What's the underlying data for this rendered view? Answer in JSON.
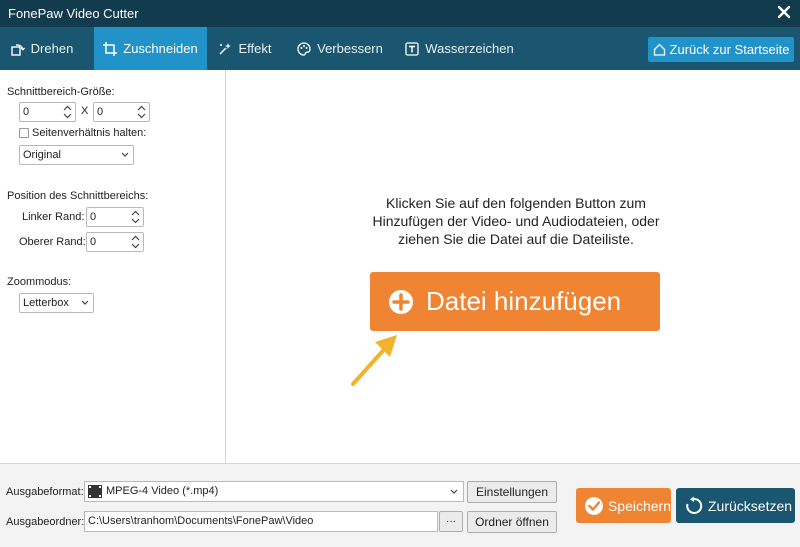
{
  "window": {
    "title": "FonePaw Video Cutter"
  },
  "tabs": [
    {
      "label": "Drehen",
      "icon": "rotate-icon"
    },
    {
      "label": "Zuschneiden",
      "icon": "crop-icon",
      "active": true
    },
    {
      "label": "Effekt",
      "icon": "effect-icon"
    },
    {
      "label": "Verbessern",
      "icon": "palette-icon"
    },
    {
      "label": "Wasserzeichen",
      "icon": "watermark-icon"
    }
  ],
  "home_button": {
    "label": "Zurück zur Startseite",
    "icon": "home-icon"
  },
  "crop": {
    "size_label": "Schnittbereich-Größe:",
    "width": "0",
    "x_label": "X",
    "height": "0",
    "keep_ratio_label": "Seitenverhältnis halten:",
    "keep_ratio_checked": false,
    "ratio_value": "Original"
  },
  "position": {
    "label": "Position des Schnittbereichs:",
    "left_label": "Linker Rand:",
    "left_value": "0",
    "top_label": "Oberer Rand:",
    "top_value": "0"
  },
  "zoom": {
    "label": "Zoommodus:",
    "value": "Letterbox"
  },
  "dropzone": {
    "hint_line1": "Klicken Sie auf den folgenden Button zum",
    "hint_line2": "Hinzufügen der Video- und Audiodateien, oder",
    "hint_line3": "ziehen Sie die Datei auf die Dateiliste.",
    "add_label": "Datei hinzufügen"
  },
  "output": {
    "format_label": "Ausgabeformat:",
    "format_value": "MPEG-4 Video (*.mp4)",
    "settings_label": "Einstellungen",
    "folder_label": "Ausgabeordner:",
    "folder_value": "C:\\Users\\tranhom\\Documents\\FonePaw\\Video",
    "browse_label": "···",
    "open_folder_label": "Ordner öffnen"
  },
  "actions": {
    "save_label": "Speichern",
    "reset_label": "Zurücksetzen"
  },
  "colors": {
    "titlebar": "#123b4e",
    "tabbar": "#1b5670",
    "active_tab": "#2293c9",
    "accent_orange": "#ef8433"
  }
}
